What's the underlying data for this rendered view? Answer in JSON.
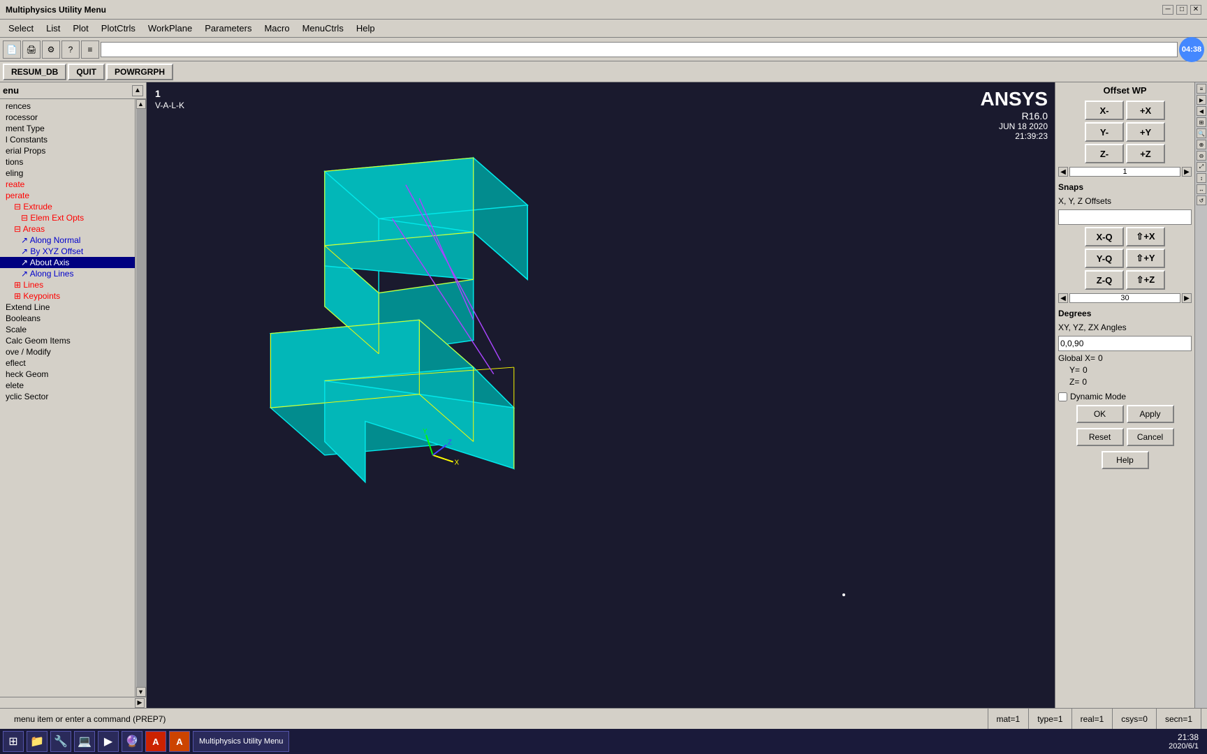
{
  "titlebar": {
    "title": "Multiphysics Utility Menu",
    "minimize": "─",
    "maximize": "□",
    "close": "✕"
  },
  "menubar": {
    "items": [
      "Select",
      "List",
      "Plot",
      "PlotCtrls",
      "WorkPlane",
      "Parameters",
      "Macro",
      "MenuCtrls",
      "Help"
    ]
  },
  "toolbar": {
    "input_placeholder": "",
    "time": "04:38"
  },
  "buttons_row": {
    "buttons": [
      "RESUM_DB",
      "QUIT",
      "POWRGRPH"
    ]
  },
  "sidebar": {
    "menu_title": "enu",
    "items": [
      {
        "label": "rences",
        "indent": 0,
        "color": "normal"
      },
      {
        "label": "rocessor",
        "indent": 0,
        "color": "normal"
      },
      {
        "label": "ment Type",
        "indent": 0,
        "color": "normal"
      },
      {
        "label": "l Constants",
        "indent": 0,
        "color": "normal"
      },
      {
        "label": "erial Props",
        "indent": 0,
        "color": "normal"
      },
      {
        "label": "tions",
        "indent": 0,
        "color": "normal"
      },
      {
        "label": "eling",
        "indent": 0,
        "color": "normal"
      },
      {
        "label": "reate",
        "indent": 0,
        "color": "red"
      },
      {
        "label": "perate",
        "indent": 0,
        "color": "red"
      },
      {
        "label": "Extrude",
        "indent": 1,
        "color": "red"
      },
      {
        "label": "Elem Ext Opts",
        "indent": 2,
        "color": "red"
      },
      {
        "label": "Areas",
        "indent": 1,
        "color": "red"
      },
      {
        "label": "Along Normal",
        "indent": 2,
        "color": "blue"
      },
      {
        "label": "By XYZ Offset",
        "indent": 2,
        "color": "blue"
      },
      {
        "label": "About Axis",
        "indent": 2,
        "color": "highlighted"
      },
      {
        "label": "Along Lines",
        "indent": 2,
        "color": "blue"
      },
      {
        "label": "Lines",
        "indent": 1,
        "color": "red"
      },
      {
        "label": "Keypoints",
        "indent": 1,
        "color": "red"
      },
      {
        "label": "Extend Line",
        "indent": 0,
        "color": "normal"
      },
      {
        "label": "Booleans",
        "indent": 0,
        "color": "normal"
      },
      {
        "label": "Scale",
        "indent": 0,
        "color": "normal"
      },
      {
        "label": "Calc Geom Items",
        "indent": 0,
        "color": "normal"
      },
      {
        "label": "ove / Modify",
        "indent": 0,
        "color": "normal"
      },
      {
        "label": "eflect",
        "indent": 0,
        "color": "normal"
      },
      {
        "label": "heck Geom",
        "indent": 0,
        "color": "normal"
      },
      {
        "label": "elete",
        "indent": 0,
        "color": "normal"
      },
      {
        "label": "yclic Sector",
        "indent": 0,
        "color": "normal"
      }
    ]
  },
  "viewport": {
    "label": "1",
    "subtitle": "V-A-L-K",
    "ansys_name": "ANSYS",
    "version": "R16.0",
    "date": "JUN 18 2020",
    "time": "21:39:23"
  },
  "right_panel": {
    "title": "Offset WP",
    "btn_x_minus": "X-",
    "btn_x_plus": "+X",
    "btn_y_minus": "Y-",
    "btn_y_plus": "+Y",
    "btn_z_minus": "Z-",
    "btn_z_plus": "+Z",
    "slider_value": "1",
    "snaps_label": "Snaps",
    "xyz_offsets_label": "X, Y, Z Offsets",
    "xyz_offset_input": "",
    "btn_xq": "X-Q",
    "btn_x_shift_plus": "⇧+X",
    "btn_yq": "Y-Q",
    "btn_y_shift_plus": "⇧+Y",
    "btn_zq": "Z-Q",
    "btn_z_shift_plus": "⇧+Z",
    "rotation_value": "30",
    "degrees_label": "Degrees",
    "xyz_angles_label": "XY, YZ, ZX Angles",
    "angles_input": "0,0,90",
    "global_x_label": "Global X=",
    "global_x_value": "0",
    "global_y_label": "Y=",
    "global_y_value": "0",
    "global_z_label": "Z=",
    "global_z_value": "0",
    "dynamic_mode_label": "Dynamic Mode",
    "btn_ok": "OK",
    "btn_apply": "Apply",
    "btn_reset": "Reset",
    "btn_cancel": "Cancel",
    "btn_help": "Help"
  },
  "statusbar": {
    "message": "menu item or enter a command (PREP7)",
    "mat": "mat=1",
    "type": "type=1",
    "real": "real=1",
    "csys": "csys=0",
    "secn": "secn=1"
  },
  "taskbar": {
    "time": "21:38",
    "date": "2020/6/1",
    "icons": [
      "⊞",
      "📁",
      "🔧",
      "💻",
      "▶",
      "🔮",
      "🅐",
      "🅰"
    ]
  }
}
